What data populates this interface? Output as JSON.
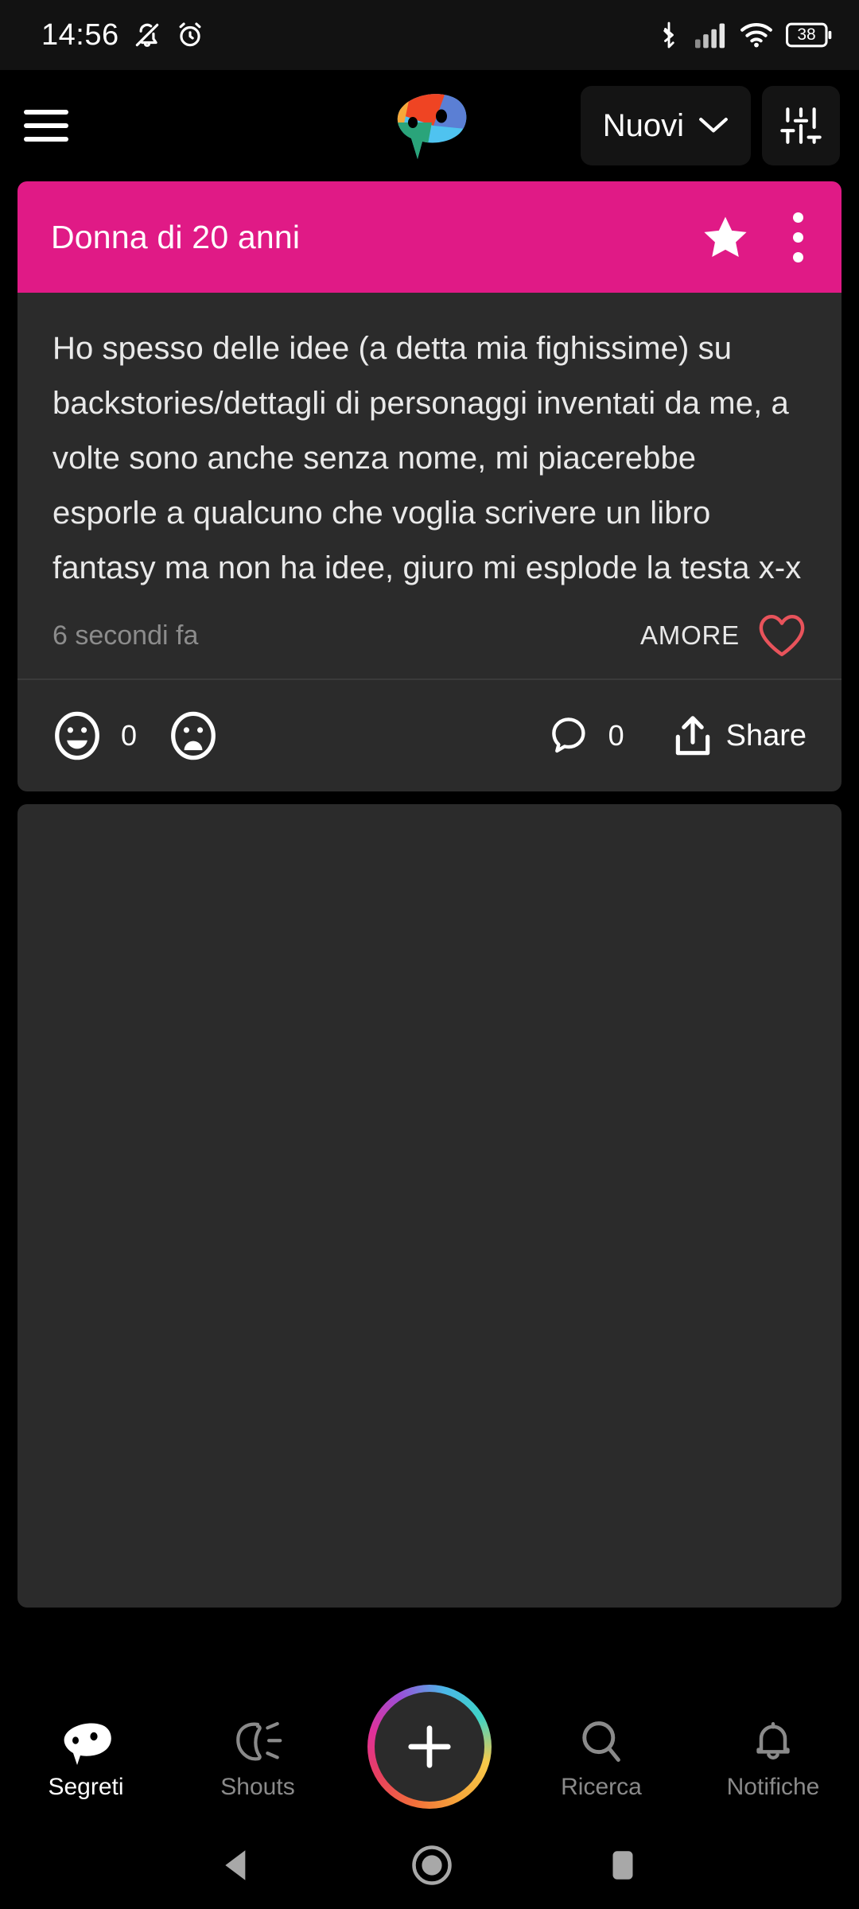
{
  "status_bar": {
    "time": "14:56",
    "battery_percent": "38",
    "icons": [
      "bell-off-icon",
      "alarm-icon",
      "bluetooth-icon",
      "cellular-signal-icon",
      "wifi-icon",
      "battery-icon"
    ]
  },
  "app_bar": {
    "menu_icon": "hamburger-menu-icon",
    "logo_icon": "app-logo-mask-icon",
    "sort_label": "Nuovi",
    "sort_chevron_icon": "chevron-down-icon",
    "filter_icon": "tune-sliders-icon"
  },
  "post": {
    "author": "Donna di 20 anni",
    "star_icon": "star-filled-icon",
    "menu_icon": "more-vertical-icon",
    "text": "Ho spesso delle idee (a detta mia fighissime) su backstories/dettagli di personaggi inventati da me, a volte sono anche senza nome, mi piacerebbe esporle a qualcuno che voglia scrivere un libro fantasy ma non ha idee, giuro mi esplode la testa x-x",
    "time_ago": "6 secondi fa",
    "mood_label": "AMORE",
    "mood_icon": "heart-outline-icon",
    "mood_color": "#e8535b",
    "like_icon": "smiley-happy-icon",
    "like_count": "0",
    "dislike_icon": "smiley-sad-icon",
    "comment_icon": "comment-bubble-icon",
    "comment_count": "0",
    "share_icon": "share-upload-icon",
    "share_label": "Share"
  },
  "bottom_nav": {
    "items": [
      {
        "label": "Segreti",
        "icon": "mask-icon",
        "active": true
      },
      {
        "label": "Shouts",
        "icon": "megaphone-icon",
        "active": false
      },
      {
        "label": "Ricerca",
        "icon": "search-icon",
        "active": false
      },
      {
        "label": "Notifiche",
        "icon": "bell-icon",
        "active": false
      }
    ],
    "create_icon": "plus-icon"
  },
  "system_nav": {
    "back_icon": "back-triangle-icon",
    "home_icon": "home-circle-icon",
    "recents_icon": "recents-square-icon"
  },
  "colors": {
    "accent_pink": "#e01a86",
    "card_bg": "#2b2b2b",
    "page_bg": "#000000",
    "heart_red": "#e8535b"
  }
}
